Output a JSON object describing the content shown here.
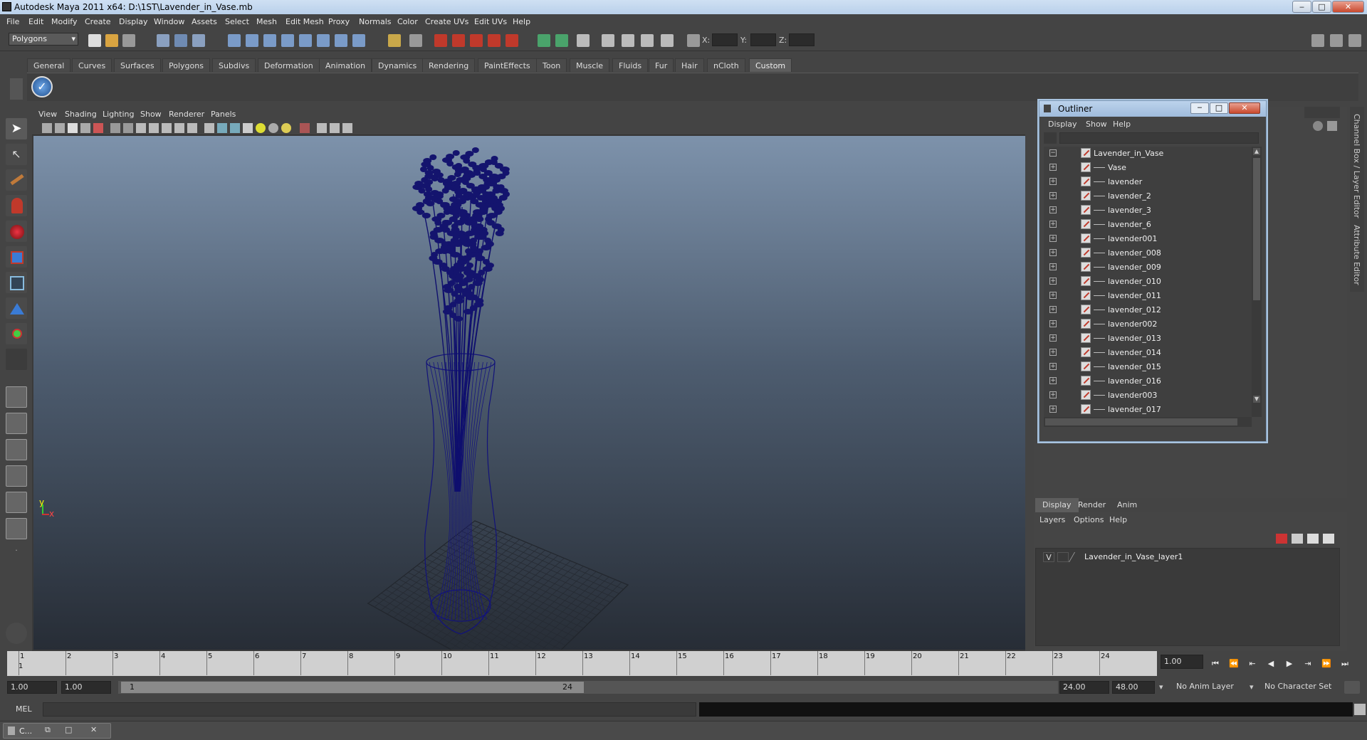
{
  "window": {
    "title": "Autodesk Maya 2011 x64: D:\\1ST\\Lavender_in_Vase.mb",
    "minimize": "‒",
    "maximize": "□",
    "close": "✕"
  },
  "menubar": [
    "File",
    "Edit",
    "Modify",
    "Create",
    "Display",
    "Window",
    "Assets",
    "Select",
    "Mesh",
    "Edit Mesh",
    "Proxy",
    "Normals",
    "Color",
    "Create UVs",
    "Edit UVs",
    "Help"
  ],
  "statusline": {
    "mode": "Polygons",
    "x_label": "X:",
    "y_label": "Y:",
    "z_label": "Z:"
  },
  "shelf": {
    "tabs": [
      "General",
      "Curves",
      "Surfaces",
      "Polygons",
      "Subdivs",
      "Deformation",
      "Animation",
      "Dynamics",
      "Rendering",
      "PaintEffects",
      "Toon",
      "Muscle",
      "Fluids",
      "Fur",
      "Hair",
      "nCloth",
      "Custom"
    ],
    "active": "Custom"
  },
  "viewport": {
    "menu": [
      "View",
      "Shading",
      "Lighting",
      "Show",
      "Renderer",
      "Panels"
    ],
    "axis_y": "y",
    "axis_x": "x"
  },
  "outliner": {
    "title": "Outliner",
    "menu": [
      "Display",
      "Show",
      "Help"
    ],
    "root": "Lavender_in_Vase",
    "items": [
      "Vase",
      "lavender",
      "lavender_2",
      "lavender_3",
      "lavender_6",
      "lavender001",
      "lavender_008",
      "lavender_009",
      "lavender_010",
      "lavender_011",
      "lavender_012",
      "lavender002",
      "lavender_013",
      "lavender_014",
      "lavender_015",
      "lavender_016",
      "lavender003",
      "lavender_017"
    ]
  },
  "side_tabs": {
    "channel_box": "Channel Box / Layer Editor",
    "attribute_editor": "Attribute Editor"
  },
  "layer_editor": {
    "tabs": [
      "Display",
      "Render",
      "Anim"
    ],
    "active_tab": "Display",
    "menu": [
      "Layers",
      "Options",
      "Help"
    ],
    "layer_visibility": "V",
    "layer_name": "Lavender_in_Vase_layer1"
  },
  "timeline": {
    "frames": [
      "1",
      "2",
      "3",
      "4",
      "5",
      "6",
      "7",
      "8",
      "9",
      "10",
      "11",
      "12",
      "13",
      "14",
      "15",
      "16",
      "17",
      "18",
      "19",
      "20",
      "21",
      "22",
      "23",
      "24"
    ],
    "current_marker": "1",
    "current_frame": "1.00"
  },
  "range": {
    "start": "1.00",
    "playback_start": "1.00",
    "slider_start": "1",
    "slider_end": "24",
    "playback_end": "24.00",
    "end": "48.00",
    "anim_layer": "No Anim Layer",
    "character_set": "No Character Set"
  },
  "command_line": {
    "label": "MEL"
  },
  "taskbar": {
    "item": "C..."
  }
}
